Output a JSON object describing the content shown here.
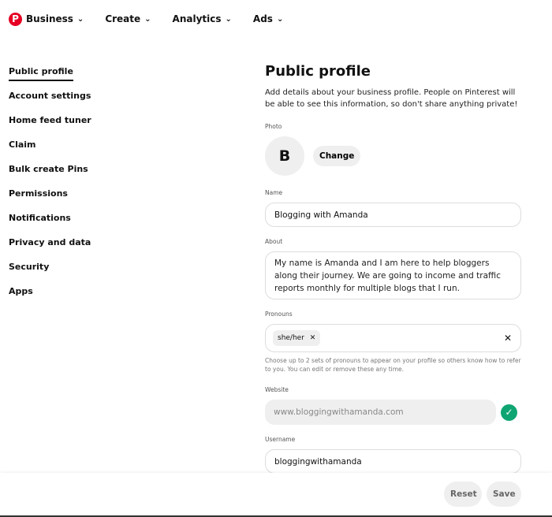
{
  "nav": {
    "logo": "P",
    "items": [
      {
        "label": "Business"
      },
      {
        "label": "Create"
      },
      {
        "label": "Analytics"
      },
      {
        "label": "Ads"
      }
    ]
  },
  "sidebar": {
    "items": [
      {
        "label": "Public profile"
      },
      {
        "label": "Account settings"
      },
      {
        "label": "Home feed tuner"
      },
      {
        "label": "Claim"
      },
      {
        "label": "Bulk create Pins"
      },
      {
        "label": "Permissions"
      },
      {
        "label": "Notifications"
      },
      {
        "label": "Privacy and data"
      },
      {
        "label": "Security"
      },
      {
        "label": "Apps"
      }
    ]
  },
  "main": {
    "title": "Public profile",
    "description": "Add details about your business profile. People on Pinterest will be able to see this information, so don't share anything private!",
    "photo": {
      "label": "Photo",
      "initial": "B",
      "change": "Change"
    },
    "name": {
      "label": "Name",
      "value": "Blogging with Amanda"
    },
    "about": {
      "label": "About",
      "value": "My name is Amanda and I am here to help bloggers along their journey. We are going to income and traffic reports monthly for multiple blogs that I run."
    },
    "pronouns": {
      "label": "Pronouns",
      "chip": "she/her",
      "hint": "Choose up to 2 sets of pronouns to appear on your profile so others know how to refer to you. You can edit or remove these any time."
    },
    "website": {
      "label": "Website",
      "placeholder": "www.bloggingwithamanda.com"
    },
    "username": {
      "label": "Username",
      "value": "bloggingwithamanda"
    }
  },
  "footer": {
    "reset": "Reset",
    "save": "Save"
  },
  "colors": {
    "brand": "#e60023",
    "verified": "#0fa573"
  }
}
